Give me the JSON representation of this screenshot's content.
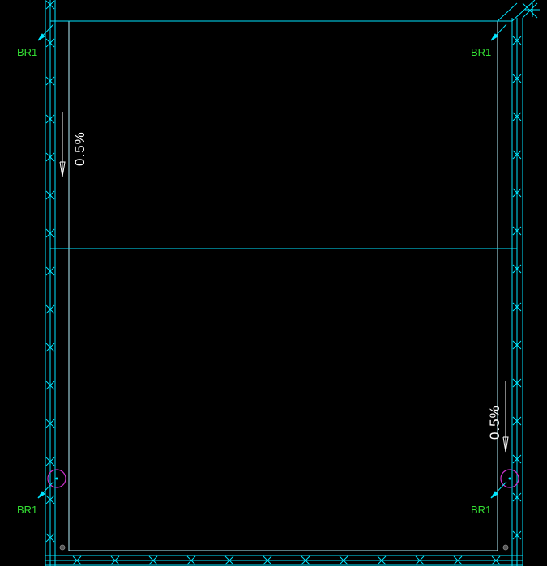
{
  "drawing": {
    "background_color": "#000000",
    "wall_color": "#00e5ff",
    "wall_inner_color": "#b8f4ff",
    "label_color": "#33dd33",
    "drain_color": "#cc33cc",
    "text_color": "#ffffff",
    "outlet_color": "#555555",
    "marker_icon": "x-cross-hatch"
  },
  "labels": {
    "roof_drain": "BR1"
  },
  "slopes": {
    "upper_slope": "0.5%",
    "lower_slope": "0.5%"
  }
}
